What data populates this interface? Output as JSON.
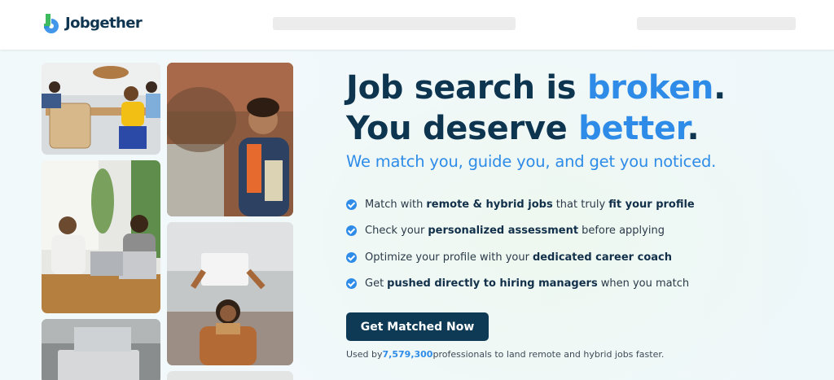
{
  "header": {
    "logo_text": "Jobgether"
  },
  "hero": {
    "headline_line1_prefix": "Job search is ",
    "headline_line1_accent": "broken",
    "headline_line1_suffix": ".",
    "headline_line2_prefix": "You deserve ",
    "headline_line2_accent": "better",
    "headline_line2_suffix": ".",
    "subheadline": "We match you, guide you, and get you noticed.",
    "features": [
      {
        "pre": "Match with",
        "bold": "remote & hybrid jobs",
        "mid": "that truly",
        "bold2": "fit your profile",
        "post": ""
      },
      {
        "pre": "Check your",
        "bold": "personalized assessment",
        "mid": "before applying",
        "bold2": "",
        "post": ""
      },
      {
        "pre": "Optimize your profile with your",
        "bold": "dedicated career coach",
        "mid": "",
        "bold2": "",
        "post": ""
      },
      {
        "pre": "Get",
        "bold": "pushed directly to hiring managers",
        "mid": "when you match",
        "bold2": "",
        "post": ""
      }
    ],
    "cta_label": "Get Matched Now",
    "used_by_prefix": "Used by",
    "used_by_count": "7,579,300",
    "used_by_suffix": "professionals to land remote and hybrid jobs faster."
  },
  "colors": {
    "accent": "#2e8ce8",
    "navy": "#0e3a55",
    "logo_green": "#3dbb5e",
    "logo_blue": "#2e8ce8"
  },
  "icons": [
    "jobgether-logo-icon",
    "check-circle-icon"
  ]
}
